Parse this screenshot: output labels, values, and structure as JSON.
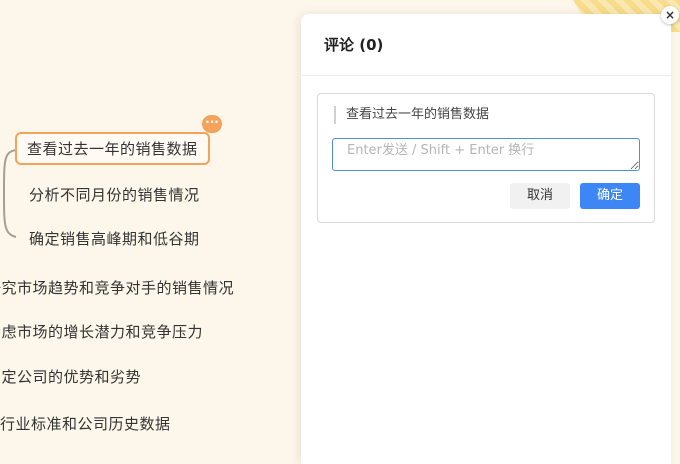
{
  "mindmap": {
    "selected_node": "查看过去一年的销售数据",
    "child_nodes": [
      "分析不同月份的销售情况",
      "确定销售高峰期和低谷期"
    ],
    "sibling_nodes": [
      "研究市场趋势和竞争对手的销售情况",
      "考虑市场的增长潜力和竞争压力",
      "确定公司的优势和劣势",
      "行业标准和公司历史数据"
    ],
    "more_badge": "···"
  },
  "comments_panel": {
    "title": "评论 (0)",
    "close_glyph": "×",
    "quote": "查看过去一年的销售数据",
    "input_placeholder": "Enter发送 / Shift + Enter 换行",
    "input_value": "",
    "cancel_label": "取消",
    "confirm_label": "确定"
  },
  "colors": {
    "canvas_bg": "#fdf6ea",
    "node_highlight": "#f5a35a",
    "primary_button": "#3d86f5",
    "input_focus_border": "#4e8fd8"
  }
}
